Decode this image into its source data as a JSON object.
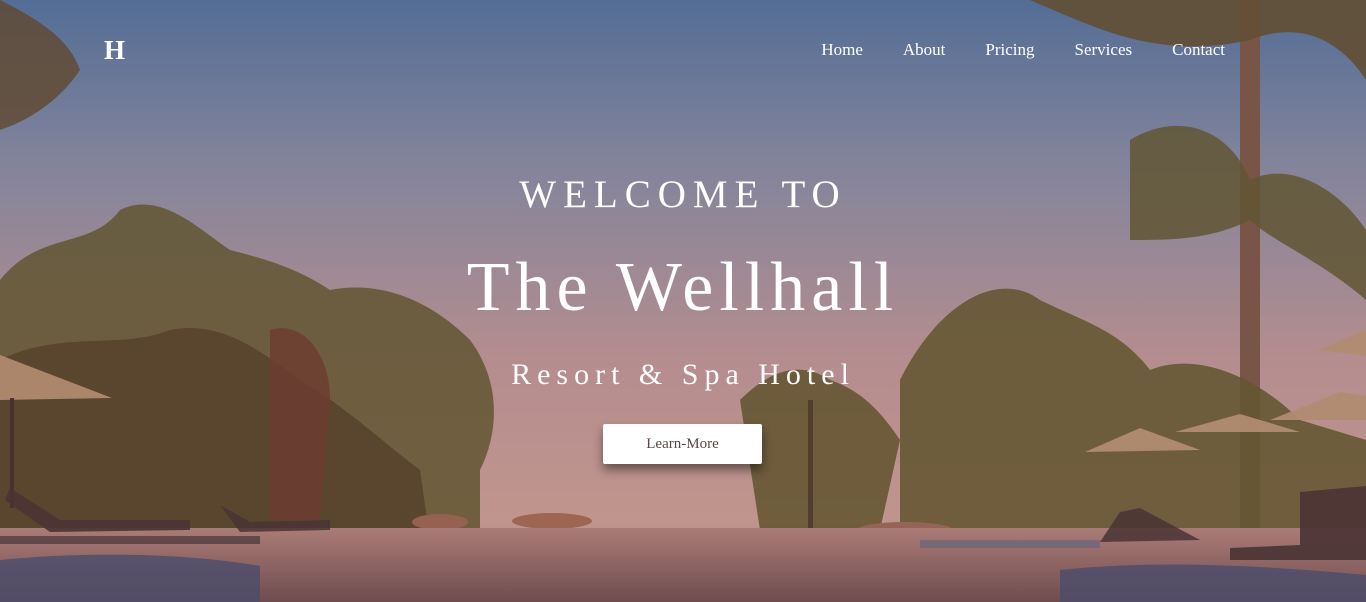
{
  "brand": {
    "logo_text": "H"
  },
  "nav": {
    "items": [
      {
        "label": "Home"
      },
      {
        "label": "About"
      },
      {
        "label": "Pricing"
      },
      {
        "label": "Services"
      },
      {
        "label": "Contact"
      }
    ]
  },
  "hero": {
    "eyebrow": "WELCOME TO",
    "title": "The Wellhall",
    "subtitle": "Resort & Spa Hotel",
    "cta_label": "Learn-More"
  },
  "colors": {
    "sky_top": "#4a79ad",
    "sky_horizon": "#d3a89e",
    "foliage": "#5f5a2c",
    "water": "#8c6a66",
    "text": "#ffffff"
  }
}
